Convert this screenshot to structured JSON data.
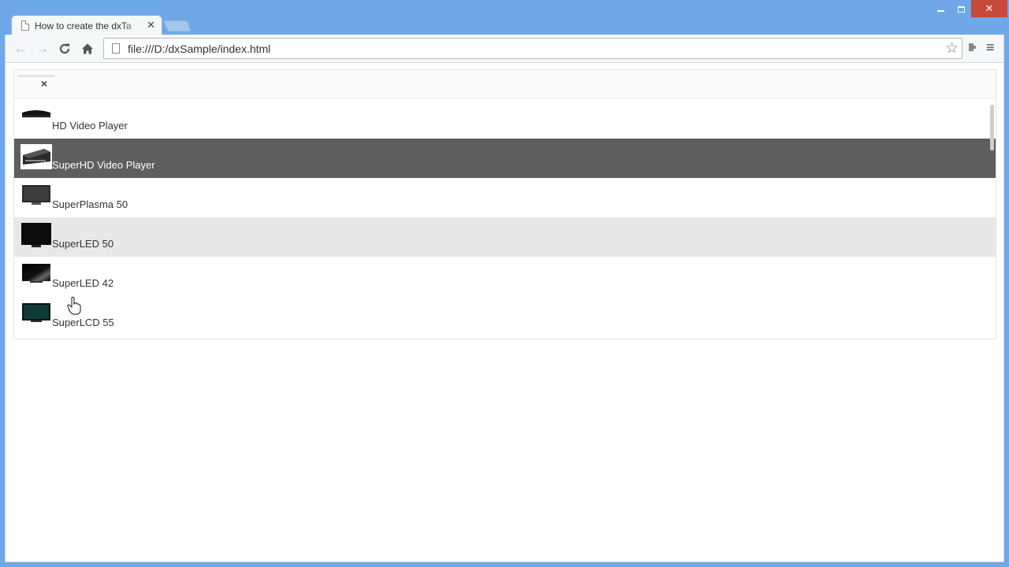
{
  "browser": {
    "tab_title": "How to create the dxTa",
    "tab_close": "✕",
    "url": "file:///D:/dxSample/index.html",
    "window_close": "✕"
  },
  "toolbar": {
    "back_icon": "←",
    "forward_icon": "→",
    "reload_icon": "C",
    "home_icon": "⌂",
    "star_icon": "☆",
    "menu_icon": "≡"
  },
  "panel": {
    "close_icon": "×",
    "items": [
      {
        "label": "HD Video Player",
        "icon": "video-player-icon",
        "state": "normal"
      },
      {
        "label": "SuperHD Video Player",
        "icon": "video-player-icon",
        "state": "selected"
      },
      {
        "label": "SuperPlasma 50",
        "icon": "tv-icon",
        "state": "normal"
      },
      {
        "label": "SuperLED 50",
        "icon": "tv-icon",
        "state": "hover"
      },
      {
        "label": "SuperLED 42",
        "icon": "tv-icon",
        "state": "normal"
      },
      {
        "label": "SuperLCD 55",
        "icon": "tv-icon",
        "state": "normal"
      }
    ]
  },
  "colors": {
    "selected_row": "#5e5e5e",
    "hover_row": "#e8e8e8",
    "frame": "#6fa8e8"
  }
}
